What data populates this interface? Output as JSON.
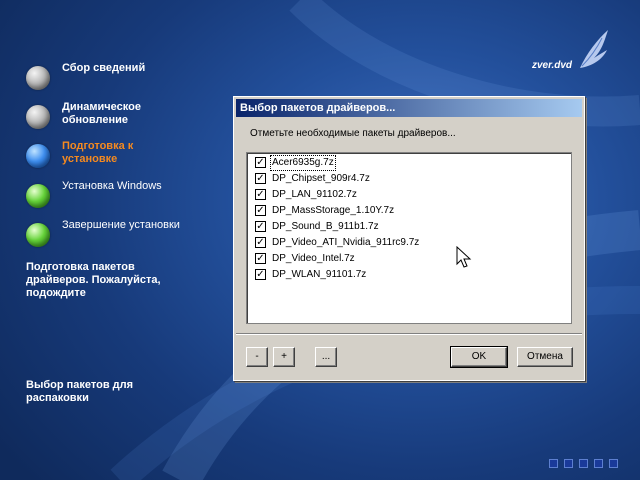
{
  "logo": {
    "text": "zver.dvd"
  },
  "steps": [
    {
      "label": "Сбор сведений",
      "state": "done",
      "orb_color": "gray"
    },
    {
      "label": "Динамическое обновление",
      "state": "done",
      "orb_color": "gray"
    },
    {
      "label": "Подготовка к установке",
      "state": "active",
      "orb_color": "blue"
    },
    {
      "label": "Установка Windows",
      "state": "pending",
      "orb_color": "green"
    },
    {
      "label": "Завершение установки",
      "state": "pending",
      "orb_color": "green"
    }
  ],
  "status": {
    "message": "Подготовка пакетов драйверов. Пожалуйста, подождите",
    "bottom_message": "Выбор пакетов для распаковки"
  },
  "dialog": {
    "title": "Выбор пакетов драйверов...",
    "instruction": "Отметьте необходимые пакеты драйверов...",
    "packages": [
      {
        "name": "Acer6935g.7z",
        "checked": true
      },
      {
        "name": "DP_Chipset_909r4.7z",
        "checked": true
      },
      {
        "name": "DP_LAN_91102.7z",
        "checked": true
      },
      {
        "name": "DP_MassStorage_1.10Y.7z",
        "checked": true
      },
      {
        "name": "DP_Sound_B_911b1.7z",
        "checked": true
      },
      {
        "name": "DP_Video_ATI_Nvidia_911rc9.7z",
        "checked": true
      },
      {
        "name": "DP_Video_Intel.7z",
        "checked": true
      },
      {
        "name": "DP_WLAN_91101.7z",
        "checked": true
      }
    ],
    "buttons": {
      "minus": "-",
      "plus": "+",
      "browse": "...",
      "ok": "OK",
      "cancel": "Отмена"
    }
  },
  "colors": {
    "active_step": "#f58a1f",
    "titlebar_start": "#0a246a",
    "titlebar_end": "#a6caf0"
  }
}
